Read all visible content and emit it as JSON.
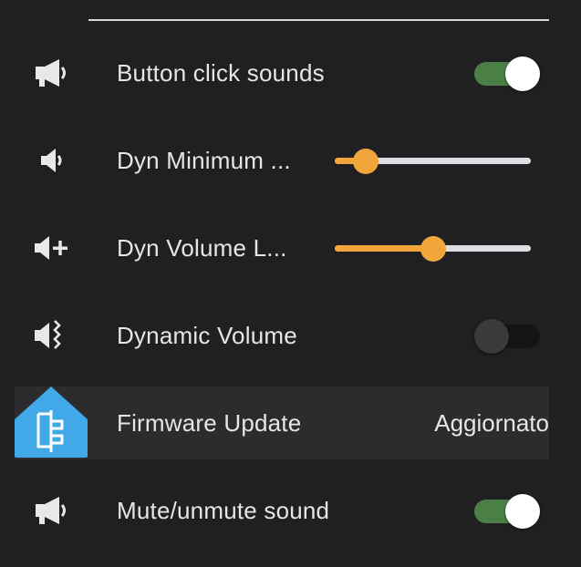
{
  "colors": {
    "background": "#202022",
    "highlight_row": "#2c2c2f",
    "toggle_on": "#4a7f46",
    "slider_accent": "#f2a53a",
    "slider_rail": "#dedde2",
    "ha_logo_blue": "#41a9e8"
  },
  "rows": [
    {
      "label": "Button click sounds",
      "icon": "bullhorn-icon",
      "control": "toggle",
      "checked": true
    },
    {
      "label": "Dyn Minimum ...",
      "icon": "volume-low-icon",
      "control": "slider",
      "value_fraction": 0.16
    },
    {
      "label": "Dyn Volume L...",
      "icon": "volume-plus-icon",
      "control": "slider",
      "value_fraction": 0.5
    },
    {
      "label": "Dynamic Volume",
      "icon": "volume-vibrate-icon",
      "control": "toggle",
      "checked": false
    },
    {
      "label": "Firmware Update",
      "icon": "home-assistant-logo-icon",
      "control": "text",
      "value": "Aggiornato"
    },
    {
      "label": "Mute/unmute sound",
      "icon": "bullhorn-icon",
      "control": "toggle",
      "checked": true
    }
  ]
}
